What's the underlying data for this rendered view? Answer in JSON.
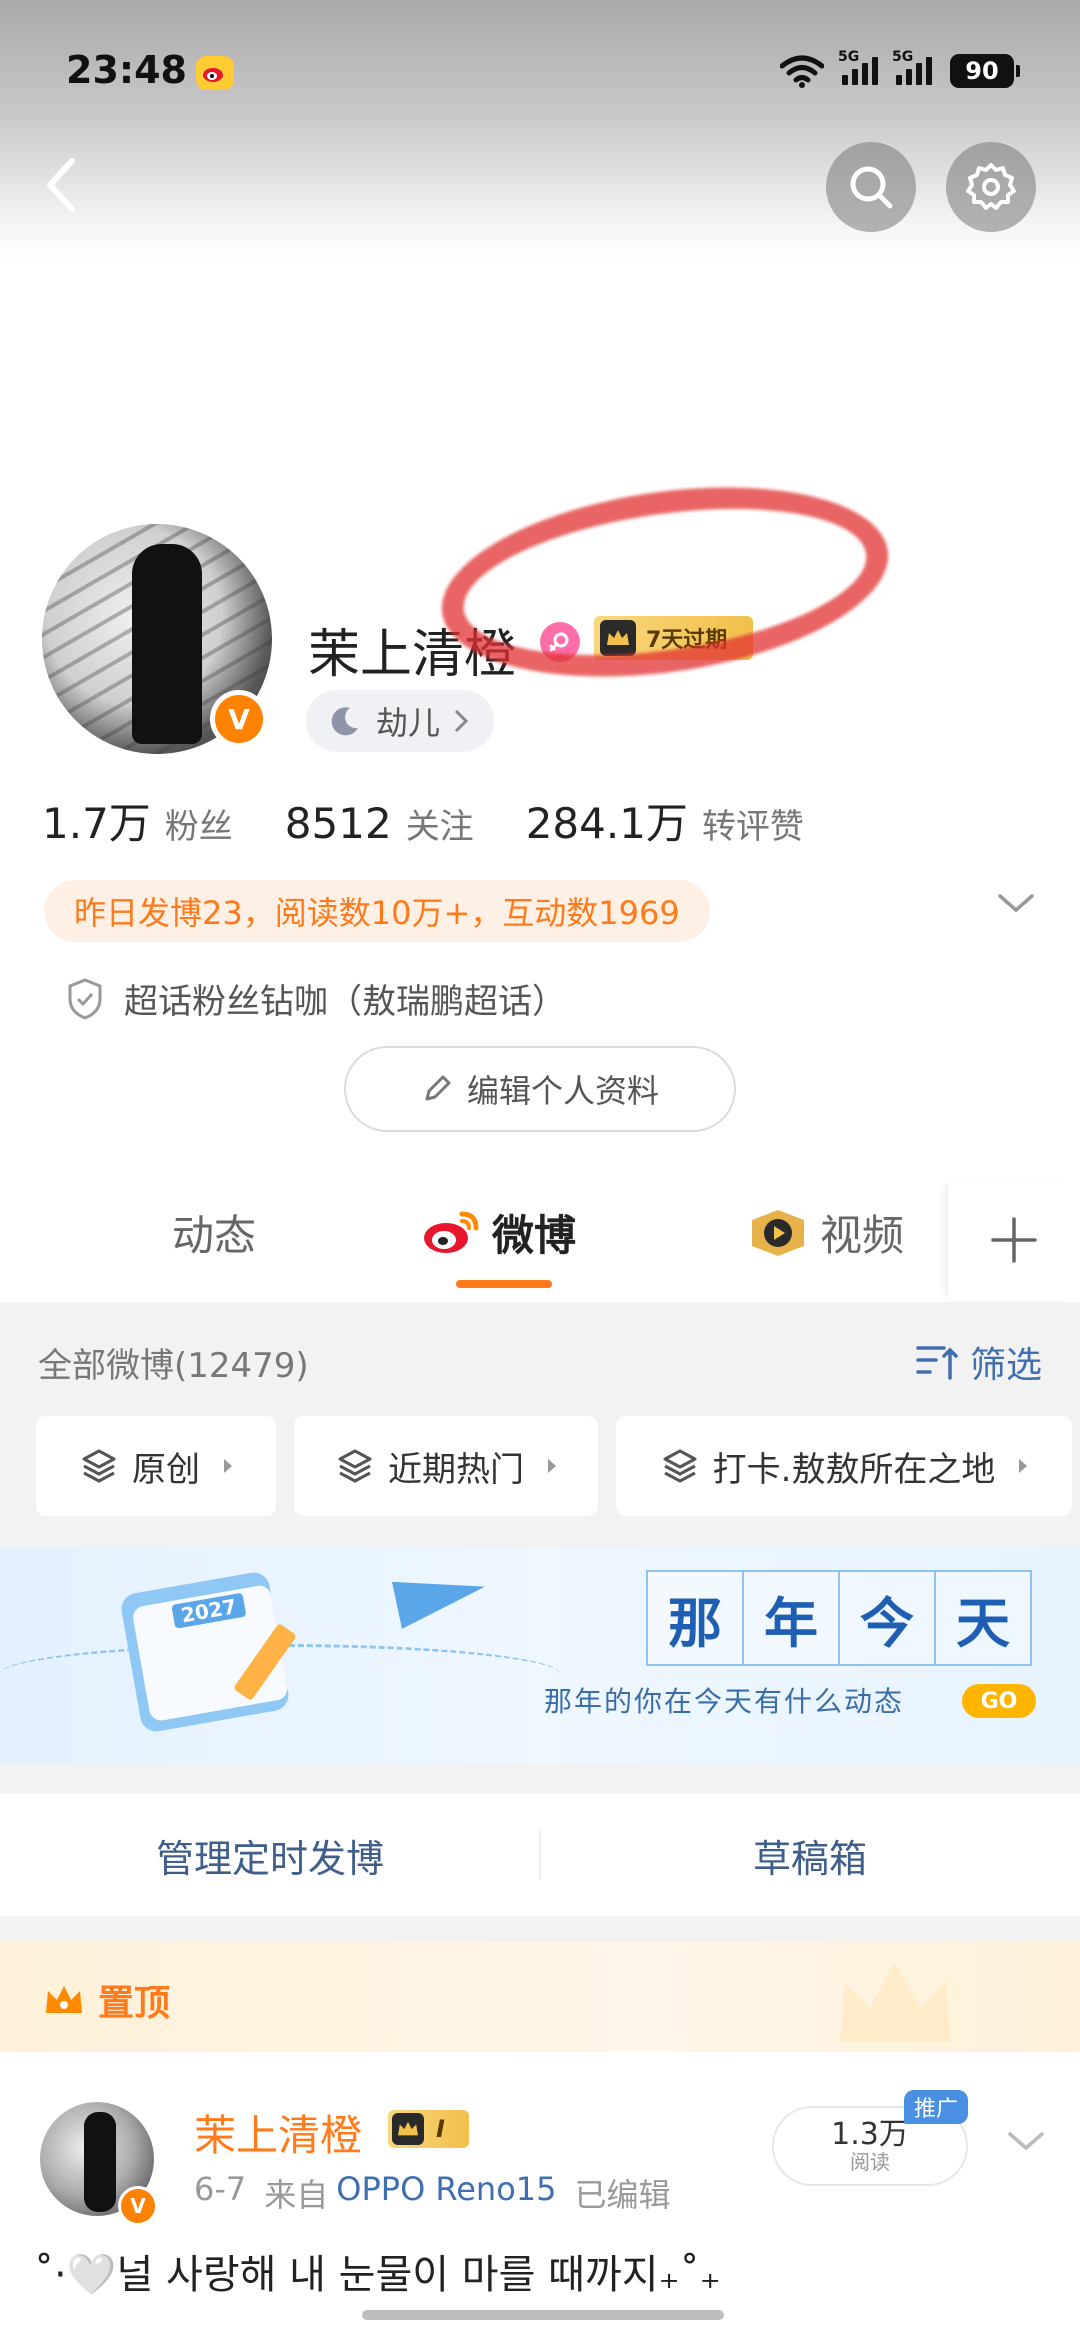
{
  "status_bar": {
    "time": "23:48",
    "network_1": "5G",
    "network_2": "5G",
    "battery": "90"
  },
  "profile": {
    "nickname": "茉上清橙",
    "vip_badge": "7天过期",
    "mood": "劫儿",
    "stats": [
      {
        "num": "1.7万",
        "label": "粉丝"
      },
      {
        "num": "8512",
        "label": "关注"
      },
      {
        "num": "284.1万",
        "label": "转评赞"
      }
    ],
    "highlight": "昨日发博23，阅读数10万+，互动数1969",
    "supertopic": "超话粉丝钻咖（敖瑞鹏超话）",
    "edit_button": "编辑个人资料"
  },
  "tabs": [
    {
      "label": "动态"
    },
    {
      "label": "微博"
    },
    {
      "label": "视频"
    }
  ],
  "feed": {
    "all_count": "全部微博(12479)",
    "filter_label": "筛选",
    "chips": [
      {
        "label": "原创"
      },
      {
        "label": "近期热门"
      },
      {
        "label": "打卡.敖敖所在之地"
      }
    ],
    "banner": {
      "year_badge": "2027",
      "chars": [
        "那",
        "年",
        "今",
        "天"
      ],
      "subtitle": "那年的你在今天有什么动态",
      "go": "GO"
    },
    "manage": {
      "scheduled": "管理定时发博",
      "drafts": "草稿箱"
    },
    "pinned": {
      "label": "置顶",
      "post": {
        "author": "茉上清橙",
        "vip_level": "I",
        "date": "6-7",
        "source_prefix": "来自",
        "device": "OPPO Reno15",
        "edited": "已编辑",
        "read_count": "1.3万",
        "read_label": "阅读",
        "promo": "推广",
        "text": "˚·🤍널 사랑해 내 눈물이 마를 때까지₊˚₊"
      }
    }
  },
  "colors": {
    "accent": "#ff7a1a",
    "link": "#3f6fb0",
    "vip_gold": "#f2c04b",
    "weibo_red": "#e6162d"
  }
}
